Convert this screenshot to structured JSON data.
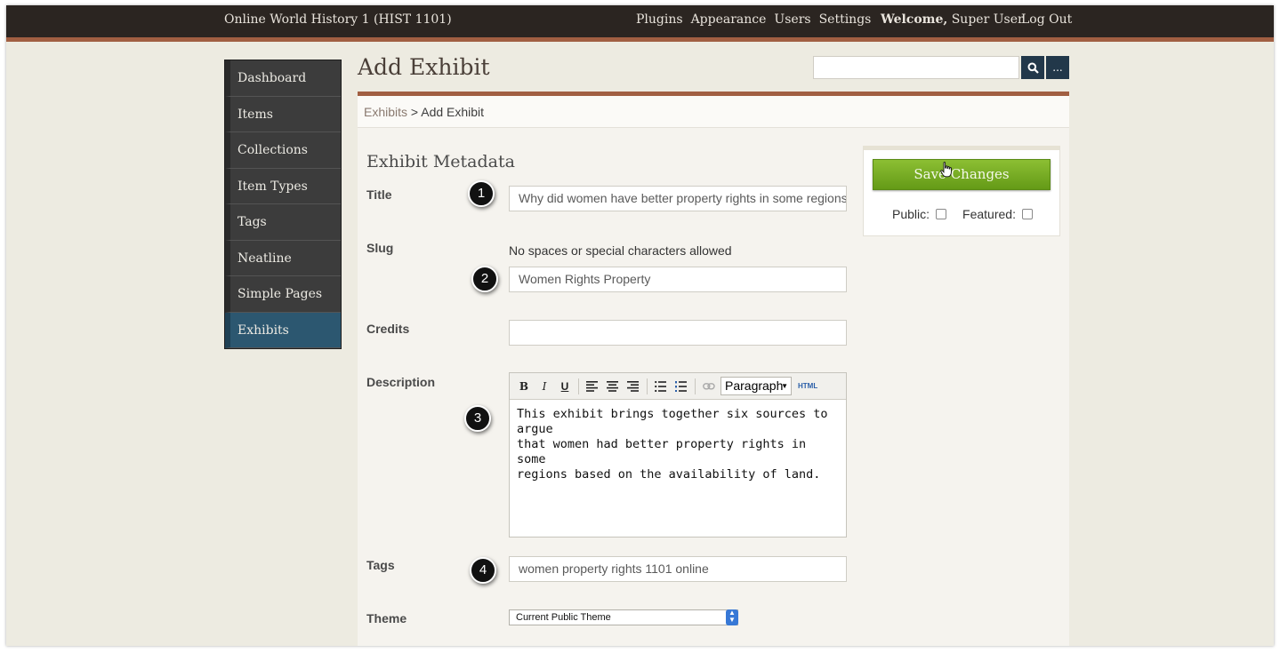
{
  "topbar": {
    "site_title": "Online World History 1 (HIST 1101)",
    "nav": [
      "Plugins",
      "Appearance",
      "Users",
      "Settings"
    ],
    "welcome_label": "Welcome,",
    "user_name": "Super User",
    "logout_label": "Log Out"
  },
  "sidebar": {
    "items": [
      {
        "label": "Dashboard"
      },
      {
        "label": "Items"
      },
      {
        "label": "Collections"
      },
      {
        "label": "Item Types"
      },
      {
        "label": "Tags"
      },
      {
        "label": "Neatline"
      },
      {
        "label": "Simple Pages"
      },
      {
        "label": "Exhibits",
        "active": true
      }
    ]
  },
  "page": {
    "title": "Add Exhibit",
    "search": {
      "placeholder": "",
      "icon": "search-icon",
      "more_label": "..."
    }
  },
  "breadcrumb": {
    "parent": "Exhibits",
    "separator": ">",
    "current": "Add Exhibit"
  },
  "form": {
    "section_title": "Exhibit Metadata",
    "title": {
      "label": "Title",
      "value": "Why did women have better property rights in some regions?"
    },
    "slug": {
      "label": "Slug",
      "helper": "No spaces or special characters allowed",
      "value": "Women Rights Property"
    },
    "credits": {
      "label": "Credits",
      "value": ""
    },
    "description": {
      "label": "Description",
      "format": "Paragraph",
      "html_label": "HTML",
      "toolbar": {
        "bold": "B",
        "italic": "I",
        "underline": "U"
      },
      "text": "This exhibit brings together six sources to argue\nthat women had better property rights in some\nregions based on the availability of land."
    },
    "tags": {
      "label": "Tags",
      "value": "women property rights 1101 online"
    },
    "theme": {
      "label": "Theme",
      "selected": "Current Public Theme"
    }
  },
  "panel": {
    "save_label": "Save Changes",
    "public_label": "Public:",
    "featured_label": "Featured:"
  },
  "markers": [
    "1",
    "2",
    "3",
    "4"
  ],
  "colors": {
    "topbar": "#2b2521",
    "accent": "#a15f42",
    "sidebar": "#3c3c3c",
    "sidebar_active": "#2c5770",
    "save_button": "#7aad24",
    "search_button": "#22384a"
  }
}
